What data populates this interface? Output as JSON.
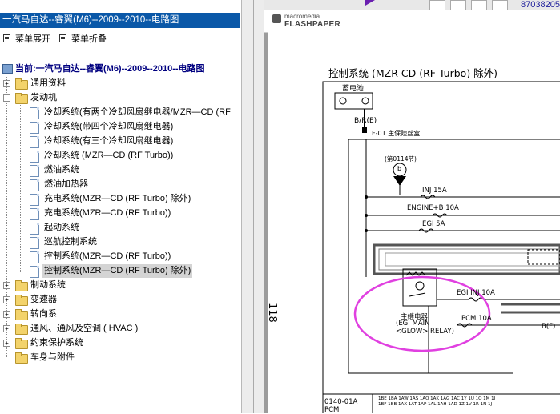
{
  "left_pane": {
    "title": "一汽马自达--睿翼(M6)--2009--2010--电路图",
    "toolbar": [
      {
        "label": "菜单展开"
      },
      {
        "label": "菜单折叠"
      }
    ],
    "root_label": "当前:一汽马自达--睿翼(M6)--2009--2010--电路图",
    "tree": [
      {
        "label": "通用资料",
        "type": "folder",
        "expander": "+"
      },
      {
        "label": "发动机",
        "type": "folder",
        "expander": "-"
      },
      {
        "label": "冷却系统(有两个冷却风扇继电器/MZR—CD (RF",
        "type": "doc"
      },
      {
        "label": "冷却系统(带四个冷却风扇继电器)",
        "type": "doc"
      },
      {
        "label": "冷却系统(有三个冷却风扇继电器)",
        "type": "doc"
      },
      {
        "label": "冷却系统 (MZR—CD (RF Turbo))",
        "type": "doc"
      },
      {
        "label": "燃油系统",
        "type": "doc"
      },
      {
        "label": "燃油加热器",
        "type": "doc"
      },
      {
        "label": "充电系统(MZR—CD (RF Turbo)   除外)",
        "type": "doc"
      },
      {
        "label": "充电系统(MZR—CD (RF Turbo))",
        "type": "doc"
      },
      {
        "label": "起动系统",
        "type": "doc"
      },
      {
        "label": "巡航控制系统",
        "type": "doc"
      },
      {
        "label": "控制系统(MZR—CD (RF Turbo))",
        "type": "doc"
      },
      {
        "label": "控制系统(MZR—CD (RF Turbo)   除外)",
        "type": "doc",
        "selected": true
      },
      {
        "label": "制动系统",
        "type": "folder",
        "expander": "+"
      },
      {
        "label": "变速器",
        "type": "folder",
        "expander": "+"
      },
      {
        "label": "转向系",
        "type": "folder",
        "expander": "+"
      },
      {
        "label": "通风、通风及空调 ( HVAC )",
        "type": "folder",
        "expander": "+"
      },
      {
        "label": "约束保护系统",
        "type": "folder",
        "expander": "+"
      },
      {
        "label": "车身与附件",
        "type": "folder",
        "expander": ""
      }
    ]
  },
  "viewer": {
    "top_code": "87038205",
    "brand_small": "macromedia",
    "brand_big": "FLASHPAPER",
    "page_number": "118",
    "diagram": {
      "title": "控制系统  (MZR-CD  (RF Turbo)  除外)",
      "battery": "蓄电池",
      "wire_br": "B/R(E)",
      "fuse_box": "F-01  主保险丝盒",
      "node_ref": "(第0114节)",
      "node_b": "b",
      "fuse_inj": "INJ 15A",
      "fuse_engine": "ENGINE+B 10A",
      "fuse_egi": "EGI 5A",
      "fuse_egi_inj": "EGI INJ 10A",
      "fuse_pcm": "PCM 10A",
      "wire_bf": "B(F)",
      "relay_1": "主继电器",
      "relay_2": "(EGI MAIN",
      "relay_3": "<GLOW> RELAY)",
      "connector": "0140-01A",
      "connector_pcm": "PCM",
      "pins_top": "1BE 1BA 1AW 1AS 1AO 1AK 1AG 1AC 1Y 1U 1Q 1M 1I",
      "pins_bottom": "1BF 1BB 1AX 1AT 1AP 1AL 1AH 1AD 1Z 1V 1R 1N 1J"
    }
  },
  "colors": {
    "title_bar": "#0a58a8",
    "selection": "#d4d4d4",
    "highlight_circle": "#e040e0",
    "viewer_bg": "#9c9c9c"
  }
}
